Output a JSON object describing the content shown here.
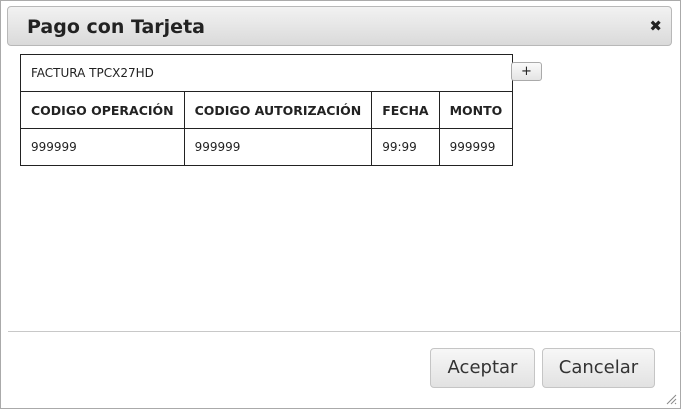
{
  "dialog": {
    "title": "Pago con Tarjeta",
    "close_icon": "close-icon"
  },
  "factura": {
    "label": "FACTURA TPCX27HD",
    "add_label": "+"
  },
  "table": {
    "headers": [
      "CODIGO OPERACIÓN",
      "CODIGO AUTORIZACIÓN",
      "FECHA",
      "MONTO"
    ],
    "rows": [
      [
        "999999",
        "999999",
        "99:99",
        "999999"
      ]
    ]
  },
  "footer": {
    "accept_label": "Aceptar",
    "cancel_label": "Cancelar"
  }
}
